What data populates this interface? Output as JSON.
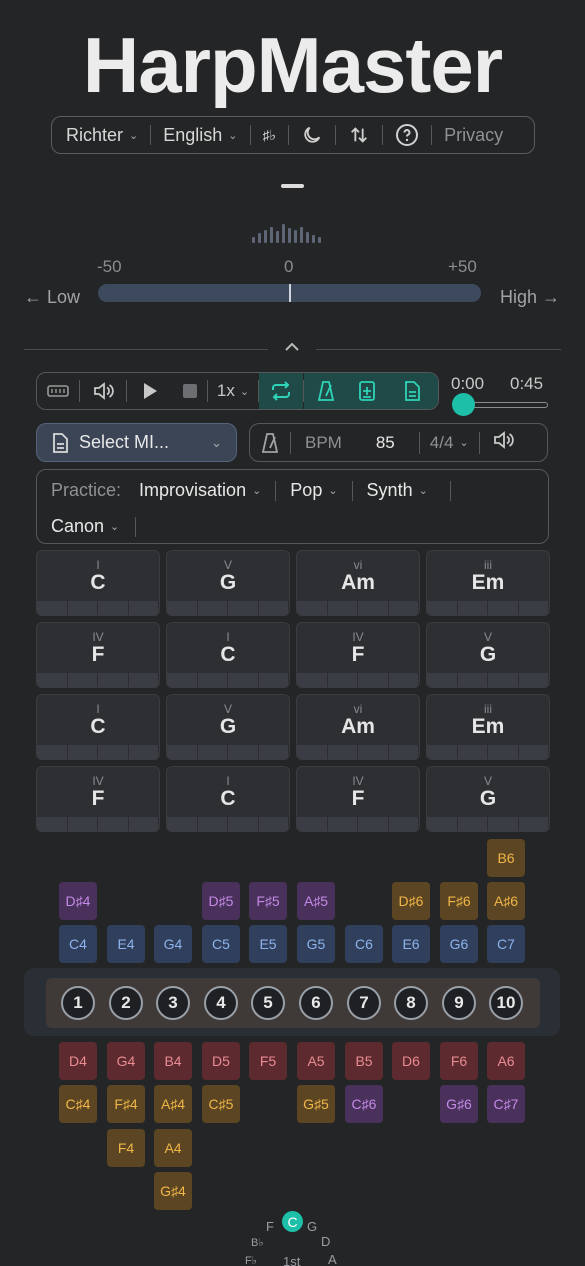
{
  "app_title": "HarpMaster",
  "nav": {
    "tuning": "Richter",
    "language": "English",
    "accidental": "♯♭",
    "privacy": "Privacy"
  },
  "pitch_meter": {
    "min_label": "-50",
    "mid_label": "0",
    "max_label": "+50",
    "low_label": "← Low",
    "high_label": "High →"
  },
  "transport": {
    "speed": "1x",
    "time_current": "0:00",
    "time_total": "0:45"
  },
  "midi": {
    "select_label": "Select MI..."
  },
  "tempo": {
    "bpm_label": "BPM",
    "bpm_value": "85",
    "time_signature": "4/4"
  },
  "practice": {
    "label": "Practice:",
    "mode": "Improvisation",
    "style": "Pop",
    "sound": "Synth",
    "progression": "Canon"
  },
  "chords": [
    {
      "numeral": "I",
      "name": "C"
    },
    {
      "numeral": "V",
      "name": "G"
    },
    {
      "numeral": "vi",
      "name": "Am"
    },
    {
      "numeral": "iii",
      "name": "Em"
    },
    {
      "numeral": "IV",
      "name": "F"
    },
    {
      "numeral": "I",
      "name": "C"
    },
    {
      "numeral": "IV",
      "name": "F"
    },
    {
      "numeral": "V",
      "name": "G"
    },
    {
      "numeral": "I",
      "name": "C"
    },
    {
      "numeral": "V",
      "name": "G"
    },
    {
      "numeral": "vi",
      "name": "Am"
    },
    {
      "numeral": "iii",
      "name": "Em"
    },
    {
      "numeral": "IV",
      "name": "F"
    },
    {
      "numeral": "I",
      "name": "C"
    },
    {
      "numeral": "IV",
      "name": "F"
    },
    {
      "numeral": "V",
      "name": "G"
    }
  ],
  "harp": {
    "blow_overblow_top": [
      "B6"
    ],
    "blow_bends_upper": [
      "D♯4",
      "D♯5",
      "F♯5",
      "A♯5",
      "D♯6",
      "F♯6",
      "A♯6"
    ],
    "blow_notes": [
      "C4",
      "E4",
      "G4",
      "C5",
      "E5",
      "G5",
      "C6",
      "E6",
      "G6",
      "C7"
    ],
    "holes": [
      "1",
      "2",
      "3",
      "4",
      "5",
      "6",
      "7",
      "8",
      "9",
      "10"
    ],
    "draw_notes": [
      "D4",
      "G4",
      "B4",
      "D5",
      "F5",
      "A5",
      "B5",
      "D6",
      "F6",
      "A6"
    ],
    "draw_bends_1": [
      "C♯4",
      "F♯4",
      "A♯4",
      "C♯5",
      "G♯5",
      "C♯6",
      "G♯6",
      "C♯7"
    ],
    "draw_bends_2": [
      "F4",
      "A4"
    ],
    "draw_bends_3": [
      "G♯4"
    ]
  },
  "circle_of_fifths": {
    "selected": "C",
    "neighbors": [
      "F",
      "G",
      "B♭",
      "D",
      "F♭",
      "A"
    ],
    "position_label": "1st"
  },
  "colors": {
    "accent": "#1dbfa8",
    "blow": "#2f3f5c",
    "draw": "#5c2a2f",
    "bend": "#5c4522",
    "overblow": "#49315c"
  }
}
